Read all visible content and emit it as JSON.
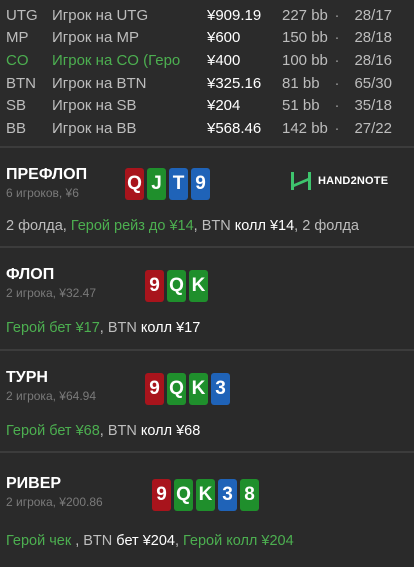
{
  "players": [
    {
      "pos": "UTG",
      "name": "Игрок на UTG",
      "stack": "¥909.19",
      "bb": "227 bb",
      "sep": "·",
      "stat": "28/17",
      "hero": false
    },
    {
      "pos": "MP",
      "name": "Игрок на MP",
      "stack": "¥600",
      "bb": "150 bb",
      "sep": "·",
      "stat": "28/18",
      "hero": false
    },
    {
      "pos": "CO",
      "name": "Игрок на CO (Геро",
      "stack": "¥400",
      "bb": "100 bb",
      "sep": "·",
      "stat": "28/16",
      "hero": true
    },
    {
      "pos": "BTN",
      "name": "Игрок на BTN",
      "stack": "¥325.16",
      "bb": "81 bb",
      "sep": "·",
      "stat": "65/30",
      "hero": false
    },
    {
      "pos": "SB",
      "name": "Игрок на SB",
      "stack": "¥204",
      "bb": "51 bb",
      "sep": "·",
      "stat": "35/18",
      "hero": false
    },
    {
      "pos": "BB",
      "name": "Игрок на BB",
      "stack": "¥568.46",
      "bb": "142 bb",
      "sep": "·",
      "stat": "27/22",
      "hero": false
    }
  ],
  "preflop": {
    "title": "ПРЕФЛОП",
    "sub": "6 игроков, ¥6",
    "cards": [
      {
        "rank": "Q",
        "color": "red"
      },
      {
        "rank": "J",
        "color": "green"
      },
      {
        "rank": "T",
        "color": "blue"
      },
      {
        "rank": "9",
        "color": "blue"
      }
    ],
    "logo": "HAND2NOTE",
    "action": {
      "a": "2 фолда, ",
      "b": "Герой рейз до ¥14",
      "c": ", BTN ",
      "d": "колл ¥14",
      "e": ", 2 фолда"
    }
  },
  "flop": {
    "title": "ФЛОП",
    "sub": "2 игрока, ¥32.47",
    "cards": [
      {
        "rank": "9",
        "color": "red"
      },
      {
        "rank": "Q",
        "color": "green"
      },
      {
        "rank": "K",
        "color": "green"
      }
    ],
    "action": {
      "a": "Герой бет ¥17",
      "b": ", BTN ",
      "c": "колл ¥17"
    }
  },
  "turn": {
    "title": "ТУРН",
    "sub": "2 игрока, ¥64.94",
    "cards": [
      {
        "rank": "9",
        "color": "red"
      },
      {
        "rank": "Q",
        "color": "green"
      },
      {
        "rank": "K",
        "color": "green"
      },
      {
        "rank": "3",
        "color": "blue"
      }
    ],
    "action": {
      "a": "Герой бет ¥68",
      "b": ", BTN ",
      "c": "колл ¥68"
    }
  },
  "river": {
    "title": "РИВЕР",
    "sub": "2 игрока, ¥200.86",
    "cards": [
      {
        "rank": "9",
        "color": "red"
      },
      {
        "rank": "Q",
        "color": "green"
      },
      {
        "rank": "K",
        "color": "green"
      },
      {
        "rank": "3",
        "color": "blue"
      },
      {
        "rank": "8",
        "color": "green"
      }
    ],
    "action": {
      "a": "Герой чек ",
      "b": ", BTN ",
      "c": "бет ¥204",
      "d": ", ",
      "e": "Герой колл ¥204"
    }
  }
}
